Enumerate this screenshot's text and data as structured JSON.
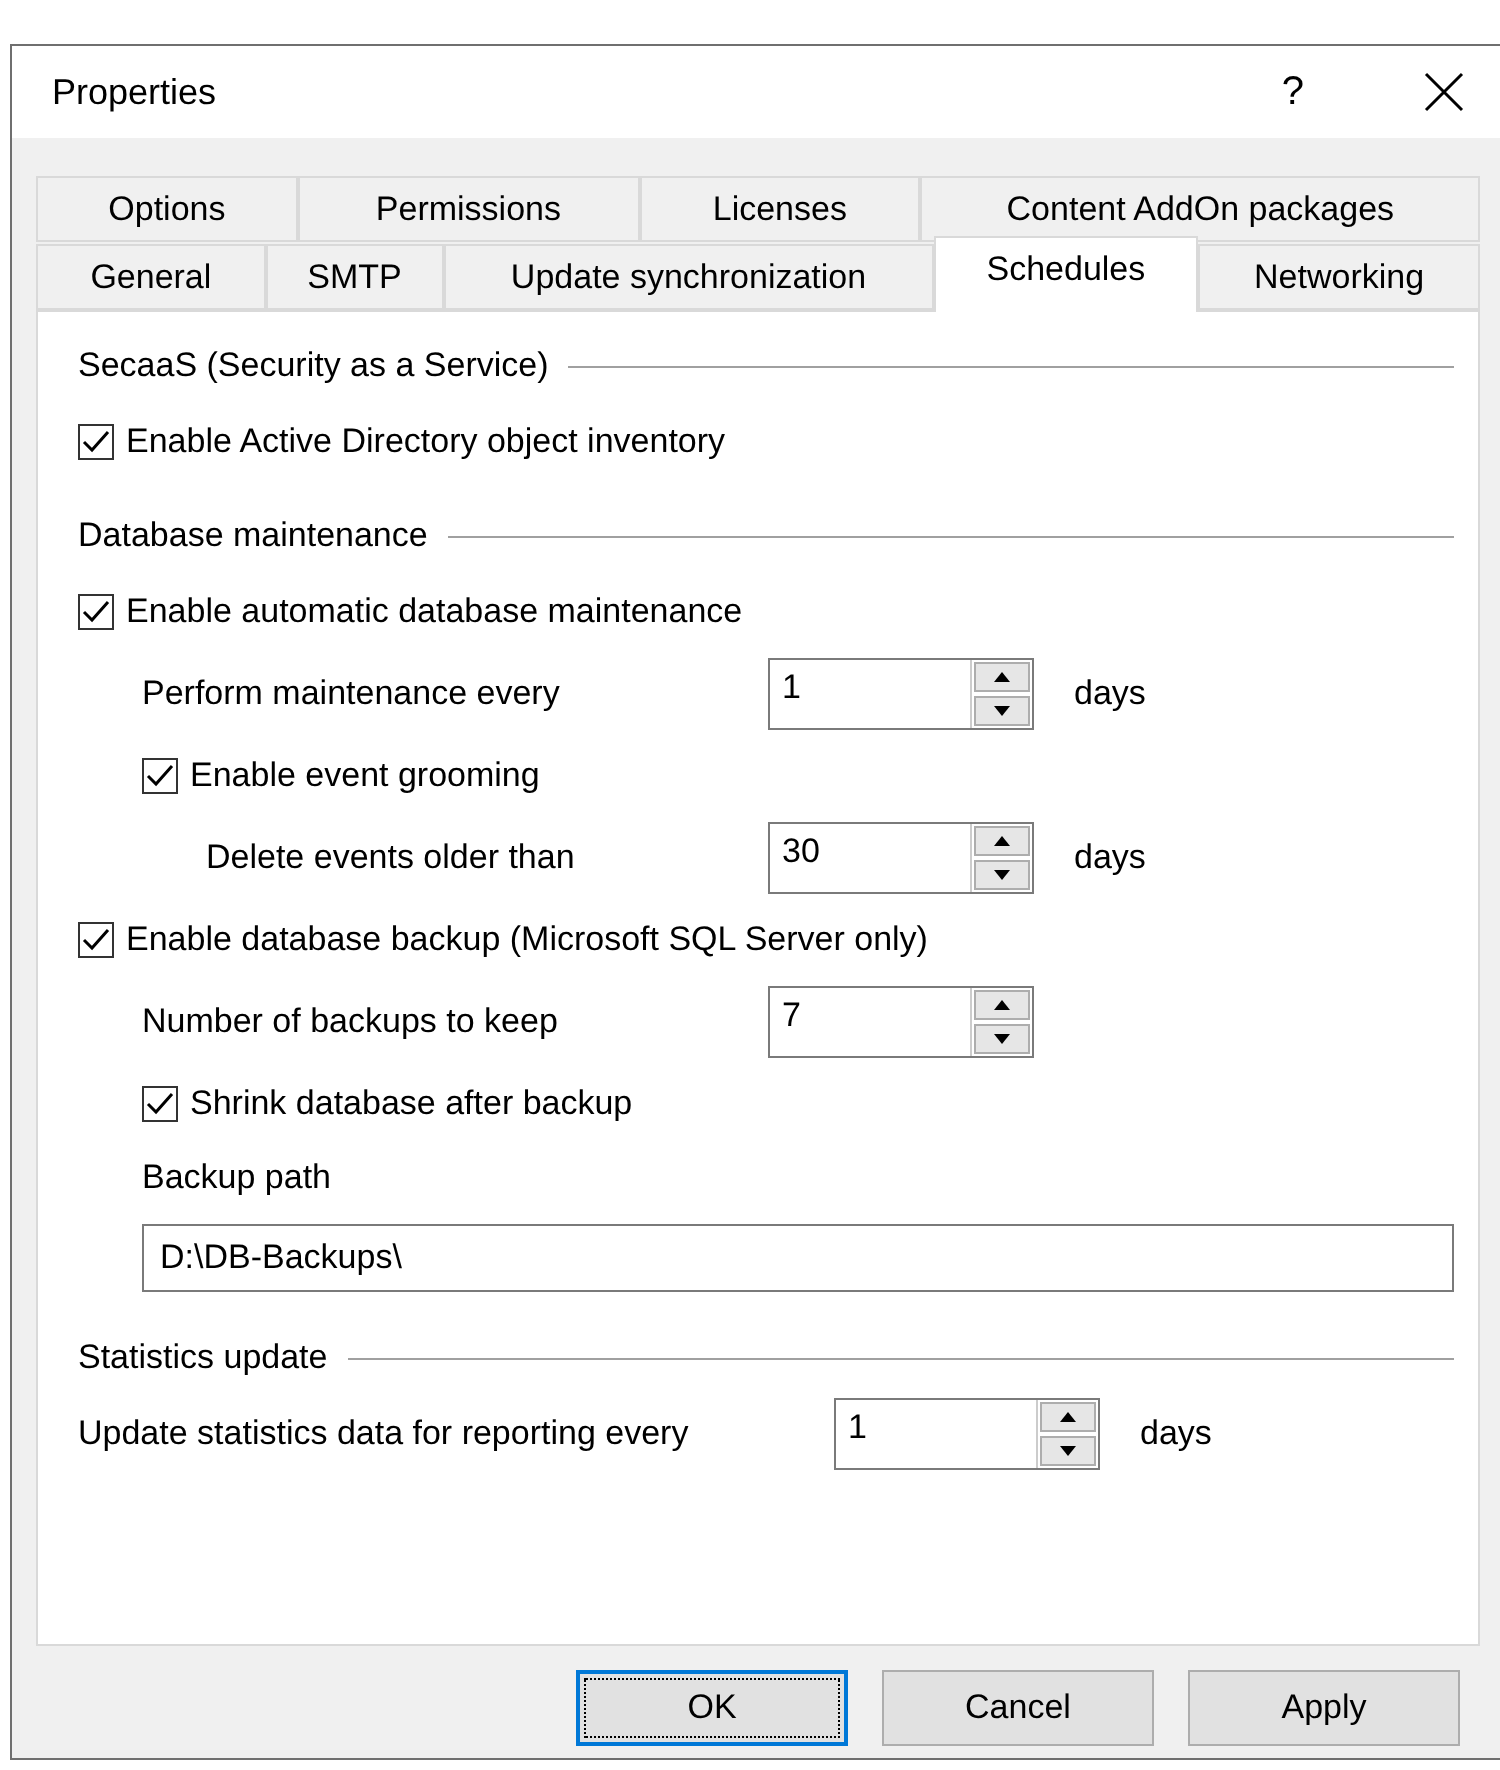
{
  "window": {
    "title": "Properties",
    "help": "?"
  },
  "tab_rows": [
    [
      {
        "label": "Options",
        "selected": false
      },
      {
        "label": "Permissions",
        "selected": false
      },
      {
        "label": "Licenses",
        "selected": false
      },
      {
        "label": "Content AddOn packages",
        "selected": false
      }
    ],
    [
      {
        "label": "General",
        "selected": false
      },
      {
        "label": "SMTP",
        "selected": false
      },
      {
        "label": "Update synchronization",
        "selected": false
      },
      {
        "label": "Schedules",
        "selected": true
      },
      {
        "label": "Networking",
        "selected": false
      }
    ]
  ],
  "sections": [
    {
      "title": "SecaaS (Security as a Service)",
      "items": [
        {
          "kind": "checkbox",
          "label": "Enable Active Directory object inventory",
          "checked": true
        }
      ]
    },
    {
      "title": "Database maintenance",
      "items": [
        {
          "kind": "checkbox",
          "label": "Enable automatic database maintenance",
          "checked": true,
          "children": [
            {
              "kind": "spinner",
              "label": "Perform maintenance every",
              "value": "1",
              "unit": "days"
            },
            {
              "kind": "checkbox",
              "label": "Enable event grooming",
              "checked": true,
              "children": [
                {
                  "kind": "spinner",
                  "label": "Delete events older than",
                  "value": "30",
                  "unit": "days"
                }
              ]
            }
          ]
        },
        {
          "kind": "checkbox",
          "label": "Enable database backup (Microsoft SQL Server only)",
          "checked": true,
          "children": [
            {
              "kind": "spinner",
              "label": "Number of backups to keep",
              "value": "7"
            },
            {
              "kind": "checkbox",
              "label": "Shrink database after backup",
              "checked": true
            },
            {
              "kind": "path",
              "label": "Backup path",
              "value": "D:\\DB-Backups\\"
            }
          ]
        }
      ]
    },
    {
      "title": "Statistics update",
      "items": [
        {
          "kind": "spinner",
          "label": "Update statistics data for reporting every",
          "value": "1",
          "unit": "days"
        }
      ]
    }
  ],
  "buttons": [
    {
      "label": "OK",
      "default": true
    },
    {
      "label": "Cancel",
      "default": false
    },
    {
      "label": "Apply",
      "default": false
    }
  ]
}
